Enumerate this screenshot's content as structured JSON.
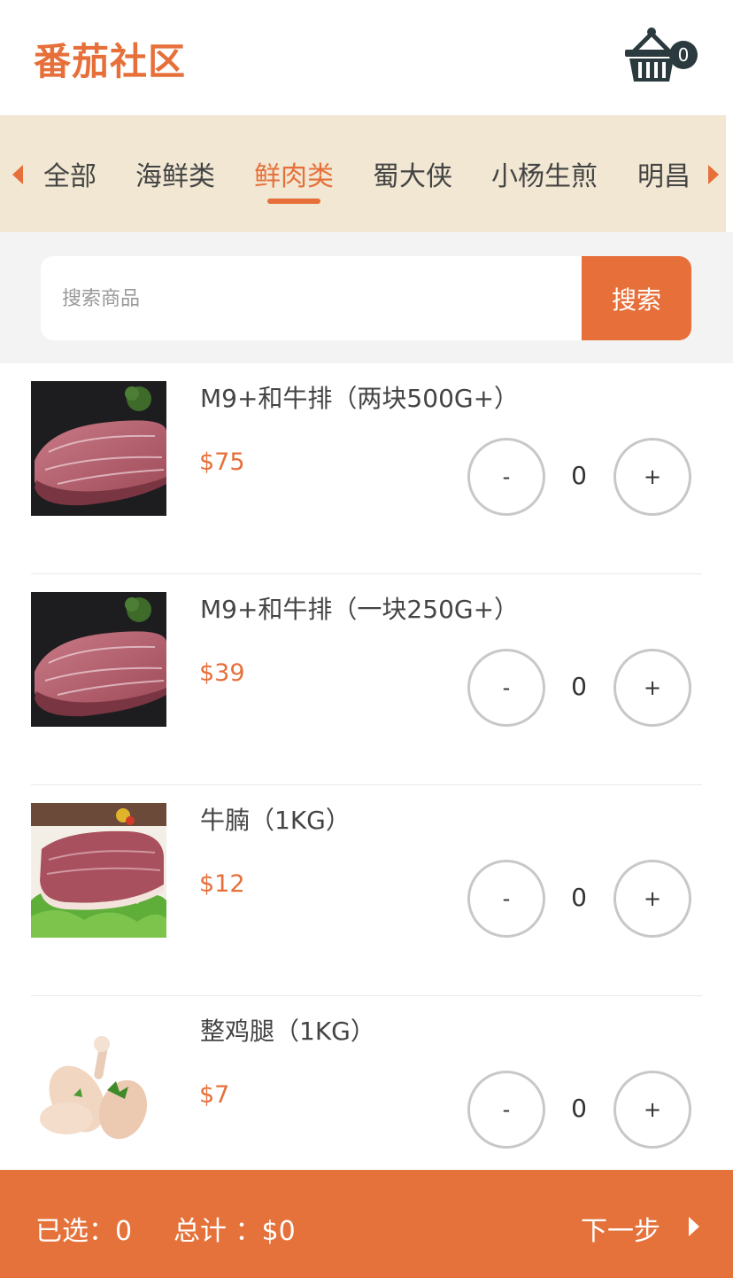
{
  "header": {
    "logo_text": "番茄社区",
    "cart_count": "0",
    "cart_icon": "basket-icon"
  },
  "categories": {
    "items": [
      "全部",
      "海鲜类",
      "鲜肉类",
      "蜀大侠",
      "小杨生煎",
      "明昌"
    ],
    "active": "鲜肉类",
    "left_icon": "caret-left-icon",
    "right_icon": "caret-right-icon"
  },
  "search": {
    "placeholder": "搜索商品",
    "button_label": "搜索"
  },
  "products": [
    {
      "name": "M9+和牛排（两块500G+）",
      "price": "$75",
      "qty": "0",
      "minus": "-",
      "plus": "+"
    },
    {
      "name": "M9+和牛排（一块250G+）",
      "price": "$39",
      "qty": "0",
      "minus": "-",
      "plus": "+"
    },
    {
      "name": "牛腩（1KG）",
      "price": "$12",
      "qty": "0",
      "minus": "-",
      "plus": "+"
    },
    {
      "name": "整鸡腿（1KG）",
      "price": "$7",
      "qty": "0",
      "minus": "-",
      "plus": "+"
    }
  ],
  "footer": {
    "selected_label": "已选：0",
    "total_label": "总计 ：$0",
    "next_label": "下一步",
    "next_icon": "caret-right-icon"
  },
  "colors": {
    "accent": "#e66f3a",
    "category_bg": "#f1e7d2",
    "badge_bg": "#2b3a3e"
  }
}
